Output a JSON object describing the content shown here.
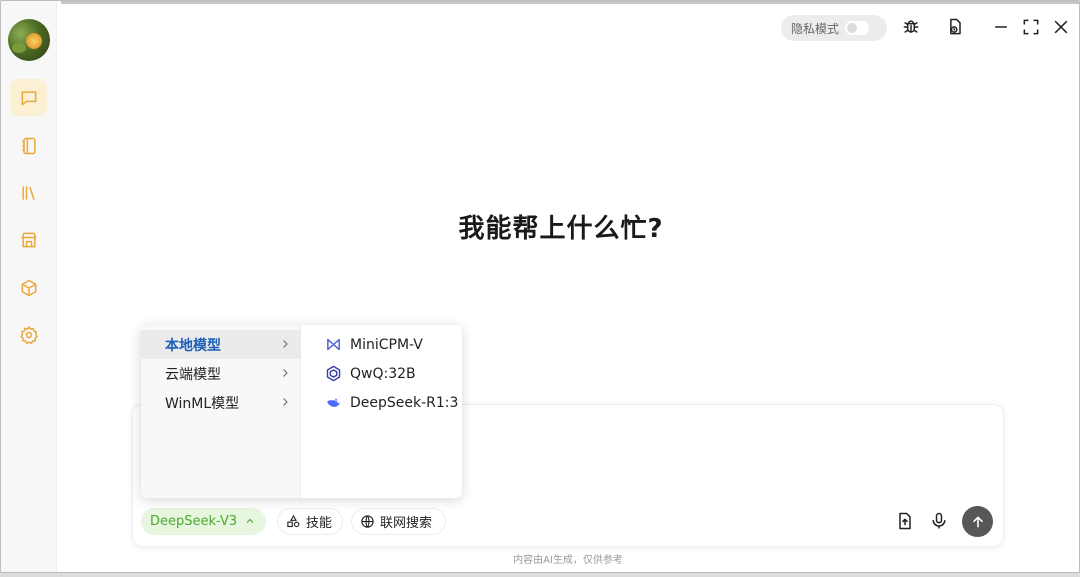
{
  "sidebar": {
    "items": [
      {
        "name": "chat",
        "icon": "chat-icon",
        "active": true
      },
      {
        "name": "notebook",
        "icon": "notebook-icon",
        "active": false
      },
      {
        "name": "library",
        "icon": "library-icon",
        "active": false
      },
      {
        "name": "store",
        "icon": "store-icon",
        "active": false
      },
      {
        "name": "models",
        "icon": "cube-icon",
        "active": false
      },
      {
        "name": "settings",
        "icon": "gear-icon",
        "active": false
      }
    ]
  },
  "header": {
    "privacy_label": "隐私模式",
    "privacy_enabled": false
  },
  "main": {
    "headline": "我能帮上什么忙?"
  },
  "composer": {
    "model_label": "DeepSeek-V3",
    "skills_label": "技能",
    "web_search_label": "联网搜索",
    "disclaimer": "内容由AI生成，仅供参考"
  },
  "model_menu": {
    "categories": [
      {
        "label": "本地模型",
        "active": true
      },
      {
        "label": "云端模型",
        "active": false
      },
      {
        "label": "WinML模型",
        "active": false
      }
    ],
    "models": [
      {
        "label": "MiniCPM-V",
        "icon": "minicpm-logo-icon"
      },
      {
        "label": "QwQ:32B",
        "icon": "qwen-logo-icon"
      },
      {
        "label": "DeepSeek-R1:3",
        "icon": "deepseek-logo-icon"
      }
    ]
  },
  "colors": {
    "accent": "#e9a93a",
    "model_chip_bg": "#e6f6df",
    "model_chip_text": "#4ca82b",
    "menu_active_text": "#1c5fb8"
  }
}
